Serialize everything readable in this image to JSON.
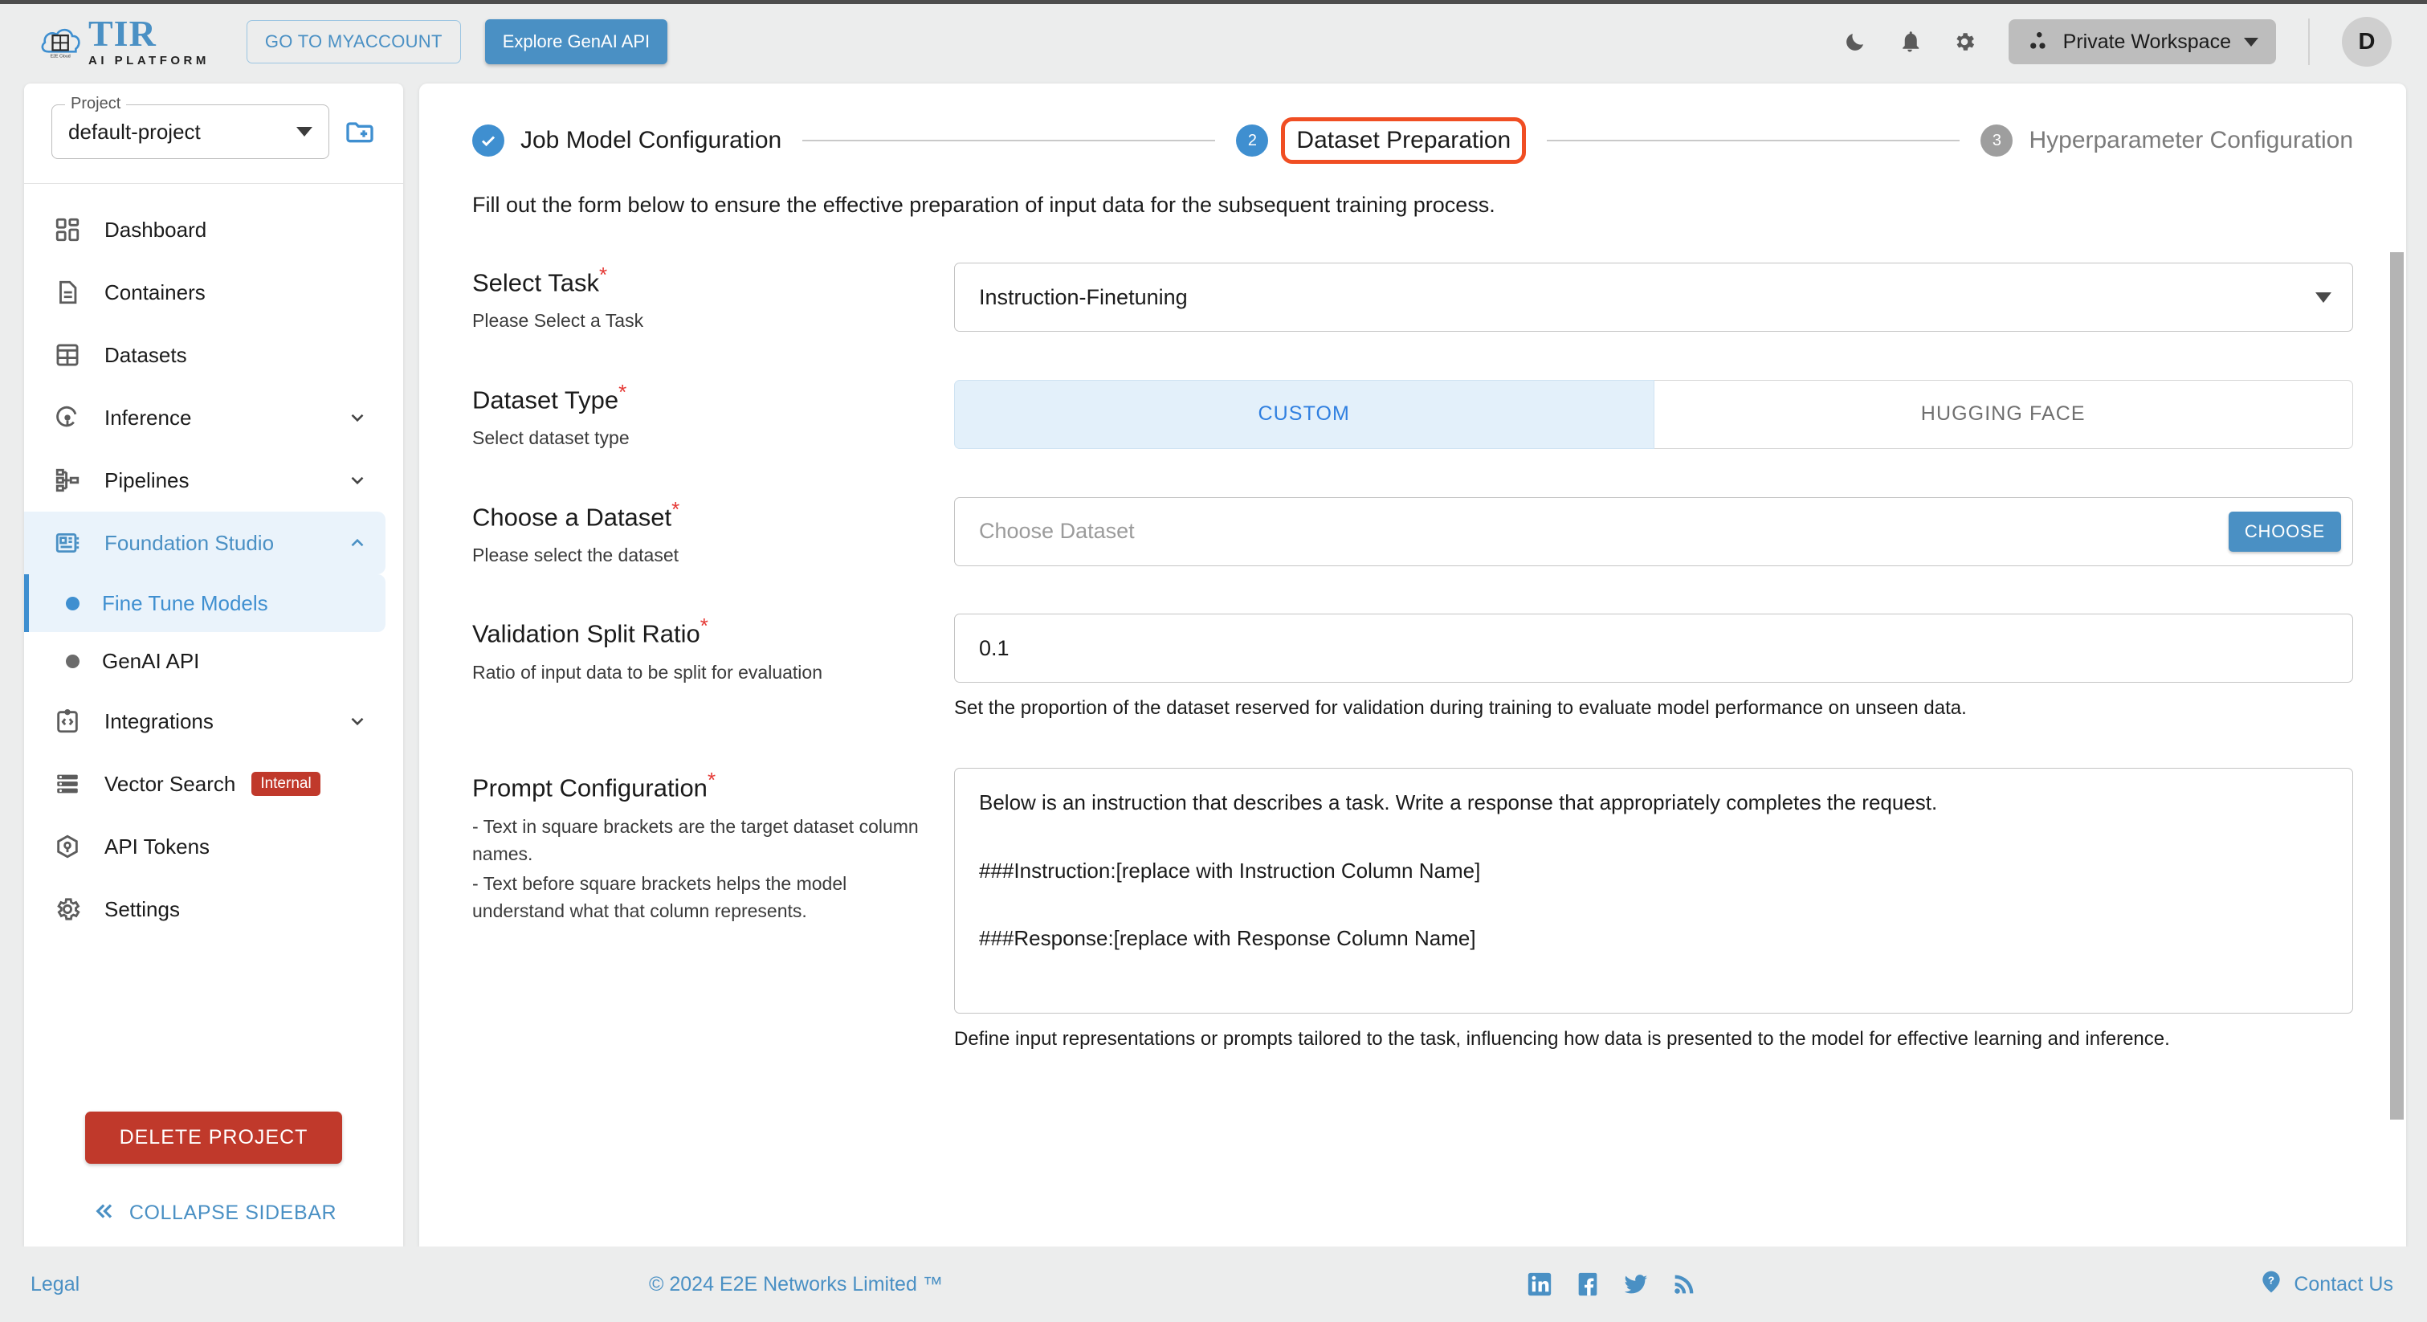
{
  "topbar": {
    "logo_title": "TIR",
    "logo_subtitle": "AI PLATFORM",
    "logo_badge": "E2E Cloud",
    "myaccount_label": "GO TO MYACCOUNT",
    "genai_label": "Explore GenAI API",
    "icons": [
      "dark-mode-icon",
      "notifications-icon",
      "settings-icon"
    ],
    "workspace_label": "Private Workspace",
    "avatar_initial": "D"
  },
  "sidebar": {
    "project_legend": "Project",
    "project_value": "default-project",
    "add_folder_icon": "add-folder-icon",
    "items": [
      {
        "label": "Dashboard",
        "icon": "dashboard-icon",
        "expandable": false
      },
      {
        "label": "Containers",
        "icon": "document-icon",
        "expandable": false
      },
      {
        "label": "Datasets",
        "icon": "grid-table-icon",
        "expandable": false
      },
      {
        "label": "Inference",
        "icon": "inference-icon",
        "expandable": true
      },
      {
        "label": "Pipelines",
        "icon": "pipelines-icon",
        "expandable": true
      },
      {
        "label": "Foundation Studio",
        "icon": "foundation-studio-icon",
        "expandable": true,
        "active": true,
        "expanded": true
      }
    ],
    "sub_items": [
      {
        "label": "Fine Tune Models",
        "selected": true
      },
      {
        "label": "GenAI API",
        "selected": false
      }
    ],
    "items_after": [
      {
        "label": "Integrations",
        "icon": "integrations-icon",
        "expandable": true
      },
      {
        "label": "Vector Search",
        "icon": "vector-search-icon",
        "expandable": false,
        "badge": "Internal"
      },
      {
        "label": "API Tokens",
        "icon": "api-tokens-icon",
        "expandable": false
      },
      {
        "label": "Settings",
        "icon": "settings-gear-icon",
        "expandable": false
      }
    ],
    "delete_project_label": "DELETE PROJECT",
    "collapse_label": "COLLAPSE SIDEBAR"
  },
  "stepper": {
    "steps": [
      {
        "number": "1",
        "label": "Job Model Configuration",
        "state": "done"
      },
      {
        "number": "2",
        "label": "Dataset Preparation",
        "state": "current",
        "highlighted": true
      },
      {
        "number": "3",
        "label": "Hyperparameter Configuration",
        "state": "pending"
      }
    ]
  },
  "main": {
    "intro": "Fill out the form below to ensure the effective preparation of input data for the subsequent training process.",
    "select_task": {
      "title": "Select Task",
      "required": "*",
      "subtitle": "Please Select a Task",
      "value": "Instruction-Finetuning"
    },
    "dataset_type": {
      "title": "Dataset Type",
      "required": "*",
      "subtitle": "Select dataset type",
      "options": [
        "CUSTOM",
        "HUGGING FACE"
      ],
      "selected": "CUSTOM"
    },
    "choose_dataset": {
      "title": "Choose a Dataset",
      "required": "*",
      "subtitle": "Please select the dataset",
      "placeholder": "Choose Dataset",
      "button_label": "CHOOSE"
    },
    "validation_split": {
      "title": "Validation Split Ratio",
      "required": "*",
      "subtitle": "Ratio of input data to be split for evaluation",
      "value": "0.1",
      "hint": "Set the proportion of the dataset reserved for validation during training to evaluate model performance on unseen data."
    },
    "prompt_config": {
      "title": "Prompt Configuration",
      "required": "*",
      "subtitle_line1": "- Text in square brackets are the target dataset column names.",
      "subtitle_line2": "- Text before square brackets helps the model understand what that column represents.",
      "line1": "Below is an instruction that describes a task. Write a response that appropriately completes the request.",
      "line2": "###Instruction:[replace with Instruction Column Name]",
      "line3": "###Response:[replace with Response Column Name]",
      "hint": "Define input representations or prompts tailored to the task, influencing how data is presented to the model for effective learning and inference."
    }
  },
  "footer": {
    "legal": "Legal",
    "copyright": "© 2024 E2E Networks Limited ™",
    "social": [
      "linkedin-icon",
      "facebook-icon",
      "twitter-icon",
      "rss-icon"
    ],
    "contact": "Contact Us"
  },
  "colors": {
    "brand_blue": "#4a90c4",
    "accent_red": "#c0392b",
    "highlight_orange": "#f04e23",
    "page_bg": "#eceded"
  }
}
